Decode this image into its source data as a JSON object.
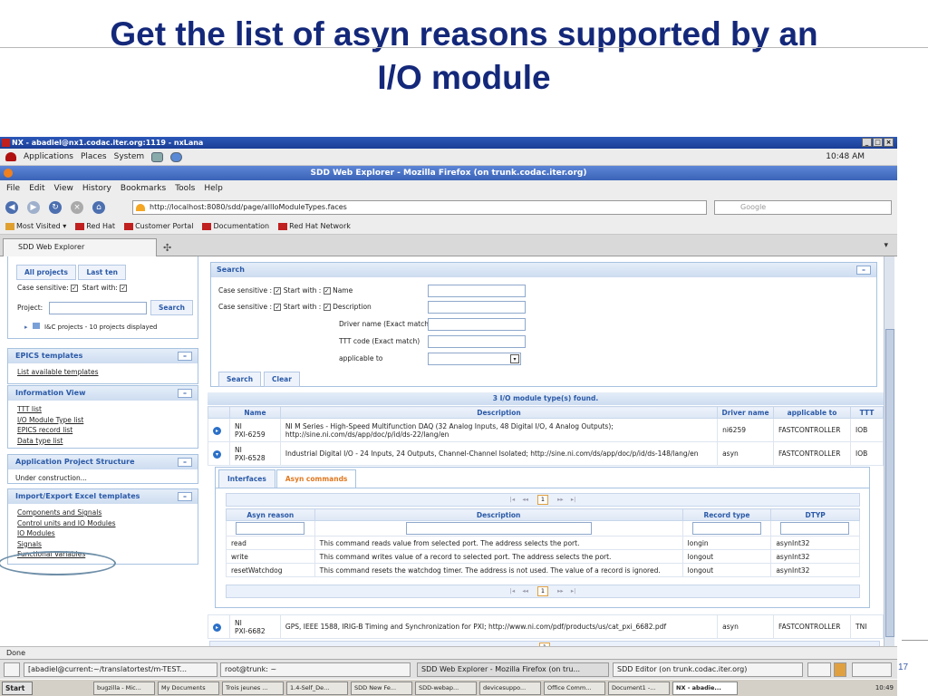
{
  "slide": {
    "title_line1": "Get the list of asyn reasons supported by an",
    "title_line2": "I/O module",
    "page_number": "17"
  },
  "nx_window": {
    "title": "NX - abadiel@nx1.codac.iter.org:1119 - nxLana"
  },
  "gnome_panel": {
    "menus": [
      "Applications",
      "Places",
      "System"
    ],
    "clock": "10:48 AM"
  },
  "firefox": {
    "title": "SDD Web Explorer - Mozilla Firefox (on trunk.codac.iter.org)",
    "menu": [
      "File",
      "Edit",
      "View",
      "History",
      "Bookmarks",
      "Tools",
      "Help"
    ],
    "url": "http://localhost:8080/sdd/page/allIoModuleTypes.faces",
    "search_placeholder": "Google",
    "bookmarks": [
      "Most Visited",
      "Red Hat",
      "Customer Portal",
      "Documentation",
      "Red Hat Network"
    ],
    "tab_title": "SDD Web Explorer",
    "status": "Done"
  },
  "left": {
    "projects": {
      "btn_all": "All projects",
      "btn_last": "Last ten",
      "case_sensitive": "Case sensitive:",
      "start_with": "Start with:",
      "project_label": "Project:",
      "search_btn": "Search",
      "tree_item": "I&C projects - 10 projects displayed"
    },
    "epics": {
      "title": "EPICS templates",
      "links": [
        "List available templates"
      ]
    },
    "info": {
      "title": "Information View",
      "links": [
        "TTT list",
        "I/O Module Type list",
        "EPICS record list",
        "Data type list"
      ]
    },
    "aps": {
      "title": "Application Project Structure",
      "text": "Under construction..."
    },
    "excel": {
      "title": "Import/Export Excel templates",
      "links": [
        "Components and Signals",
        "Control units and IO Modules",
        "IO Modules",
        "Signals",
        "Functional Variables"
      ]
    }
  },
  "search_form": {
    "title": "Search",
    "row1_case": "Case sensitive :",
    "row1_start": "Start with :",
    "row1_field": "Name",
    "row2_case": "Case sensitive :",
    "row2_start": "Start with :",
    "row2_field": "Description",
    "driver_label": "Driver name (Exact match)",
    "ttt_label": "TTT code (Exact match)",
    "applicable_label": "applicable to",
    "search_btn": "Search",
    "clear_btn": "Clear"
  },
  "results": {
    "count_text": "3 I/O module type(s) found.",
    "columns": [
      "Name",
      "Description",
      "Driver name",
      "applicable to",
      "TTT"
    ],
    "rows": [
      {
        "name1": "NI",
        "name2": "PXI-6259",
        "desc": "NI M Series - High-Speed Multifunction DAQ (32 Analog Inputs, 48 Digital I/O, 4 Analog Outputs); http://sine.ni.com/ds/app/doc/p/id/ds-22/lang/en",
        "driver": "ni6259",
        "applicable": "FASTCONTROLLER",
        "ttt": "IOB"
      },
      {
        "name1": "NI",
        "name2": "PXI-6528",
        "desc": "Industrial Digital I/O - 24 Inputs, 24 Outputs, Channel-Channel Isolated; http://sine.ni.com/ds/app/doc/p/id/ds-148/lang/en",
        "driver": "asyn",
        "applicable": "FASTCONTROLLER",
        "ttt": "IOB"
      },
      {
        "name1": "NI",
        "name2": "PXI-6682",
        "desc": "GPS, IEEE 1588, IRIG-B Timing and Synchronization for PXI; http://www.ni.com/pdf/products/us/cat_pxi_6682.pdf",
        "driver": "asyn",
        "applicable": "FASTCONTROLLER",
        "ttt": "TNI"
      }
    ]
  },
  "subpanel": {
    "tabs": [
      "Interfaces",
      "Asyn commands"
    ],
    "pager_page": "1",
    "columns": [
      "Asyn reason",
      "Description",
      "Record type",
      "DTYP"
    ],
    "rows": [
      {
        "reason": "read",
        "desc": "This command reads value from selected port. The address selects the port.",
        "record": "longin",
        "dtyp": "asynInt32"
      },
      {
        "reason": "write",
        "desc": "This command writes value of a record to selected port. The address selects the port.",
        "record": "longout",
        "dtyp": "asynInt32"
      },
      {
        "reason": "resetWatchdog",
        "desc": "This command resets the watchdog timer. The address is not used. The value of a record is ignored.",
        "record": "longout",
        "dtyp": "asynInt32"
      }
    ]
  },
  "bottom_pager": "1",
  "gnome_tasks": [
    "[abadiel@current:~/translatortest/m-TEST...",
    "root@trunk: ~",
    "SDD Web Explorer - Mozilla Firefox (on tru...",
    "SDD Editor  (on trunk.codac.iter.org)"
  ],
  "windows_taskbar": {
    "start": "Start",
    "items": [
      "bugzilla - Mic...",
      "My Documents",
      "Trois jeunes ...",
      "1.4-Self_De...",
      "SDD New Fe...",
      "SDD-webap...",
      "devicesuppo...",
      "Office Comm...",
      "Document1 -...",
      "NX - abadie..."
    ],
    "clock": "10:49"
  }
}
